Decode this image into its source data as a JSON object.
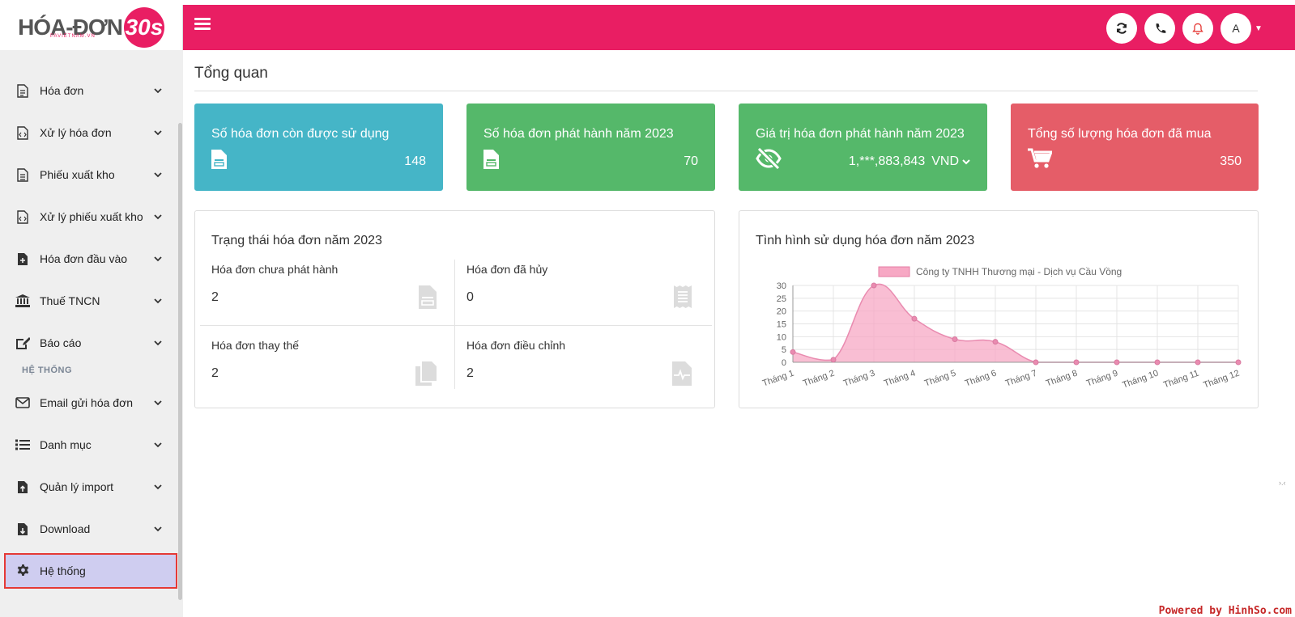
{
  "logo": {
    "text": "HÓA-ĐƠN",
    "badge": "30s",
    "sub": "PAVIETNAM.VN"
  },
  "topbar": {
    "avatar_initial": "A",
    "icons": [
      "refresh-icon",
      "phone-icon",
      "bell-icon"
    ]
  },
  "sidebar": {
    "items": [
      {
        "label": "Hóa đơn",
        "icon": "file-invoice-icon"
      },
      {
        "label": "Xử lý hóa đơn",
        "icon": "file-code-icon"
      },
      {
        "label": "Phiếu xuất kho",
        "icon": "file-lines-icon"
      },
      {
        "label": "Xử lý phiếu xuất kho",
        "icon": "file-code-icon"
      },
      {
        "label": "Hóa đơn đầu vào",
        "icon": "file-plus-icon"
      },
      {
        "label": "Thuế TNCN",
        "icon": "bank-icon"
      },
      {
        "label": "Báo cáo",
        "icon": "edit-report-icon"
      }
    ],
    "section_label": "HỆ THỐNG",
    "system_items": [
      {
        "label": "Email gửi hóa đơn",
        "icon": "envelope-icon"
      },
      {
        "label": "Danh mục",
        "icon": "list-icon"
      },
      {
        "label": "Quản lý import",
        "icon": "file-upload-icon"
      },
      {
        "label": "Download",
        "icon": "file-download-icon"
      }
    ],
    "active_item": {
      "label": "Hệ thống",
      "icon": "gear-icon"
    }
  },
  "page": {
    "title": "Tổng quan"
  },
  "stats": [
    {
      "title": "Số hóa đơn còn được sử dụng",
      "value": "148",
      "color": "#45b5c7",
      "icon": "invoice-icon"
    },
    {
      "title": "Số hóa đơn phát hành năm 2023",
      "value": "70",
      "color": "#55b86a",
      "icon": "invoice-icon"
    },
    {
      "title": "Giá trị hóa đơn phát hành năm 2023",
      "value": "1,***,883,843",
      "currency": "VND",
      "color": "#55b86a",
      "icon": "eye-slash-icon"
    },
    {
      "title": "Tổng số lượng hóa đơn đã mua",
      "value": "350",
      "color": "#e55d68",
      "icon": "cart-icon"
    }
  ],
  "status_panel": {
    "title": "Trạng thái hóa đơn năm 2023",
    "cells": [
      {
        "label": "Hóa đơn chưa phát hành",
        "value": "2",
        "icon": "file-invoice-icon"
      },
      {
        "label": "Hóa đơn đã hủy",
        "value": "0",
        "icon": "receipt-icon"
      },
      {
        "label": "Hóa đơn thay thế",
        "value": "2",
        "icon": "copy-icon"
      },
      {
        "label": "Hóa đơn điều chỉnh",
        "value": "2",
        "icon": "file-waveform-icon"
      }
    ]
  },
  "chart_panel": {
    "title": "Tình hình sử dụng hóa đơn năm 2023"
  },
  "chart_data": {
    "type": "area",
    "categories": [
      "Tháng 1",
      "Tháng 2",
      "Tháng 3",
      "Tháng 4",
      "Tháng 5",
      "Tháng 6",
      "Tháng 7",
      "Tháng 8",
      "Tháng 9",
      "Tháng 10",
      "Tháng 11",
      "Tháng 12"
    ],
    "series": [
      {
        "name": "Công ty TNHH Thương mại - Dịch vụ Cầu Vồng",
        "values": [
          4,
          1,
          30,
          17,
          9,
          8,
          0,
          0,
          0,
          0,
          0,
          0
        ],
        "color": "#f7a8c4"
      }
    ],
    "ylim": [
      0,
      30
    ],
    "yticks": [
      0,
      5,
      10,
      15,
      20,
      25,
      30
    ],
    "legend": "top",
    "grid": true
  },
  "footer": {
    "credit": "Powered by HinhSo.com"
  }
}
